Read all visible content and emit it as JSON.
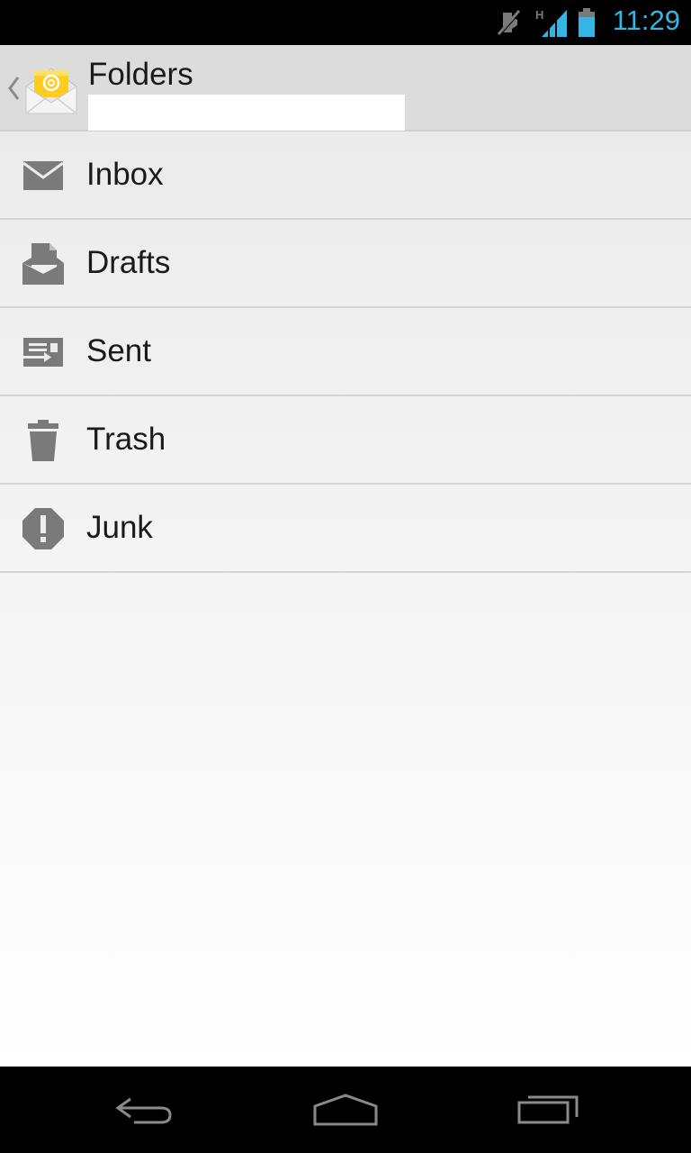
{
  "status_bar": {
    "time": "11:29",
    "network_label": "H",
    "icons": [
      "muted-icon",
      "signal-icon",
      "battery-icon"
    ],
    "accent_color": "#33b5e5"
  },
  "action_bar": {
    "title": "Folders",
    "app_icon": "email-app-icon",
    "up_icon": "up-caret-icon"
  },
  "folders": [
    {
      "label": "Inbox",
      "icon": "inbox-icon"
    },
    {
      "label": "Drafts",
      "icon": "drafts-icon"
    },
    {
      "label": "Sent",
      "icon": "sent-icon"
    },
    {
      "label": "Trash",
      "icon": "trash-icon"
    },
    {
      "label": "Junk",
      "icon": "junk-icon"
    }
  ],
  "nav_bar": {
    "icons": [
      "back-icon",
      "home-icon",
      "recent-apps-icon"
    ]
  }
}
